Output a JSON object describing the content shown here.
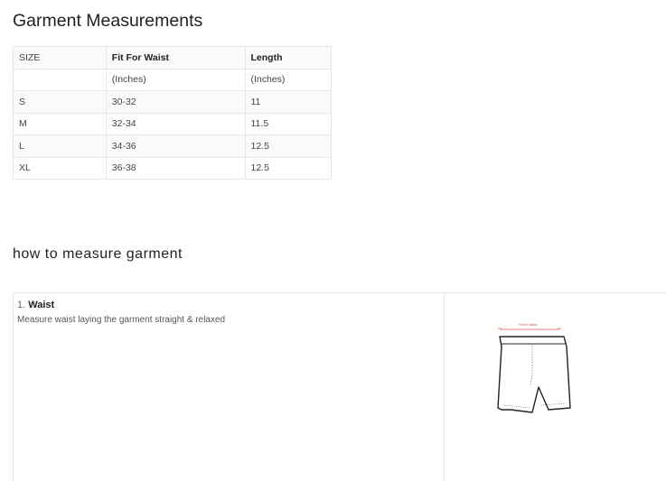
{
  "page": {
    "title": "Garment Measurements",
    "section_title": "how to measure garment"
  },
  "size_table": {
    "headers": [
      "SIZE",
      "Fit For Waist",
      "Length"
    ],
    "units": [
      "",
      "(Inches)",
      "(Inches)"
    ],
    "rows": [
      [
        "S",
        "30-32",
        "11"
      ],
      [
        "M",
        "32-34",
        "11.5"
      ],
      [
        "L",
        "34-36",
        "12.5"
      ],
      [
        "XL",
        "36-38",
        "12.5"
      ]
    ]
  },
  "measure": {
    "steps": [
      {
        "number": "1.",
        "name": "Waist",
        "description": "Measure waist laying the garment straight & relaxed"
      }
    ],
    "diagram_label": "Fit for waist",
    "colors": {
      "measure_line": "#e05050",
      "outline": "#222222"
    }
  }
}
